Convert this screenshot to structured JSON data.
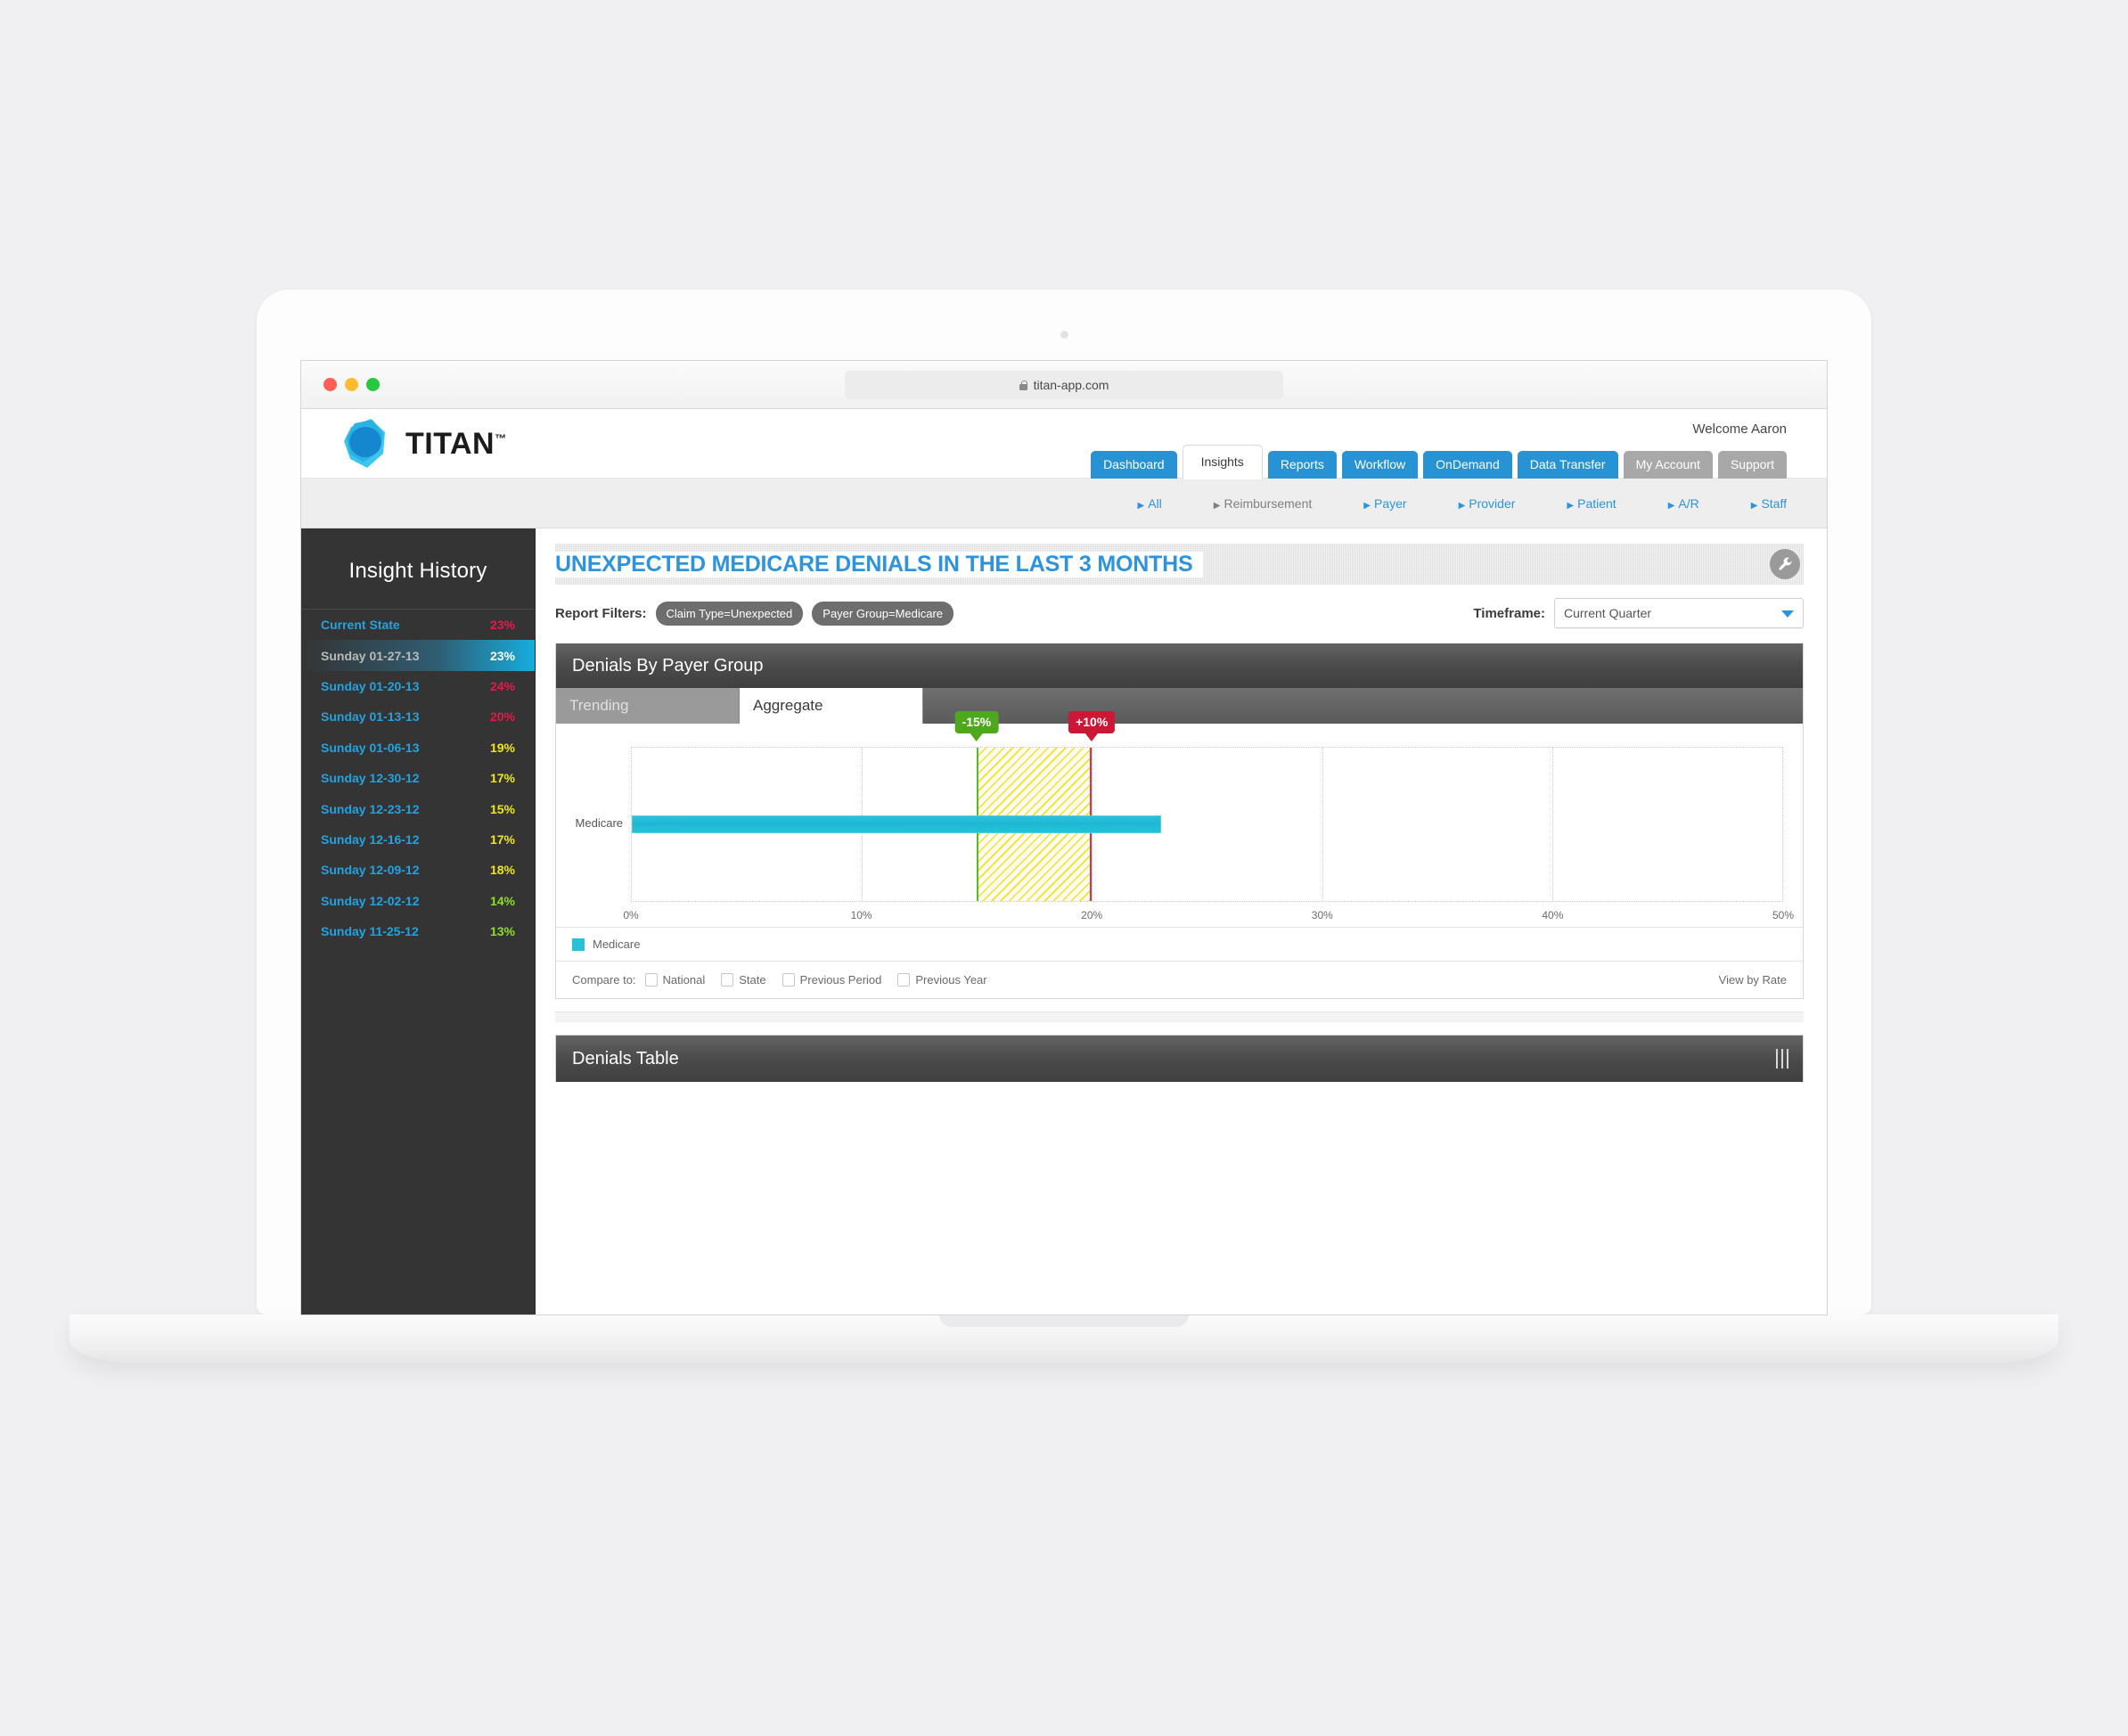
{
  "browser": {
    "url": "titan-app.com",
    "lock_icon": "lock-icon"
  },
  "header": {
    "logo_text": "TITAN",
    "logo_tm": "™",
    "welcome": "Welcome Aaron",
    "tabs": [
      {
        "label": "Dashboard",
        "state": "blue"
      },
      {
        "label": "Insights",
        "state": "active"
      },
      {
        "label": "Reports",
        "state": "blue"
      },
      {
        "label": "Workflow",
        "state": "blue"
      },
      {
        "label": "OnDemand",
        "state": "blue"
      },
      {
        "label": "Data Transfer",
        "state": "blue"
      },
      {
        "label": "My Account",
        "state": "grey"
      },
      {
        "label": "Support",
        "state": "grey"
      }
    ]
  },
  "subnav": {
    "items": [
      {
        "label": "All",
        "muted": false
      },
      {
        "label": "Reimbursement",
        "muted": true
      },
      {
        "label": "Payer",
        "muted": false
      },
      {
        "label": "Provider",
        "muted": false
      },
      {
        "label": "Patient",
        "muted": false
      },
      {
        "label": "A/R",
        "muted": false
      },
      {
        "label": "Staff",
        "muted": false
      }
    ]
  },
  "sidebar": {
    "title": "Insight History",
    "rows": [
      {
        "label": "Current State",
        "value": "23%",
        "color": "#e8184a",
        "selected": false
      },
      {
        "label": "Sunday 01-27-13",
        "value": "23%",
        "color": "#ffffff",
        "selected": true
      },
      {
        "label": "Sunday 01-20-13",
        "value": "24%",
        "color": "#e8184a",
        "selected": false
      },
      {
        "label": "Sunday 01-13-13",
        "value": "20%",
        "color": "#e8184a",
        "selected": false
      },
      {
        "label": "Sunday 01-06-13",
        "value": "19%",
        "color": "#efe715",
        "selected": false
      },
      {
        "label": "Sunday 12-30-12",
        "value": "17%",
        "color": "#efe715",
        "selected": false
      },
      {
        "label": "Sunday 12-23-12",
        "value": "15%",
        "color": "#efe715",
        "selected": false
      },
      {
        "label": "Sunday 12-16-12",
        "value": "17%",
        "color": "#efe715",
        "selected": false
      },
      {
        "label": "Sunday 12-09-12",
        "value": "18%",
        "color": "#efe715",
        "selected": false
      },
      {
        "label": "Sunday 12-02-12",
        "value": "14%",
        "color": "#8ddc2a",
        "selected": false
      },
      {
        "label": "Sunday 11-25-12",
        "value": "13%",
        "color": "#8ddc2a",
        "selected": false
      }
    ]
  },
  "report": {
    "title": "UNEXPECTED MEDICARE DENIALS IN THE LAST 3 MONTHS",
    "settings_icon": "wrench-icon",
    "filters_label": "Report Filters:",
    "filters": [
      "Claim Type=Unexpected",
      "Payer Group=Medicare"
    ],
    "timeframe_label": "Timeframe:",
    "timeframe_value": "Current Quarter",
    "timeframe_caret": "chevron-down-icon"
  },
  "chart_panel": {
    "title": "Denials By Payer Group",
    "tabs": [
      {
        "label": "Trending",
        "active": false
      },
      {
        "label": "Aggregate",
        "active": true
      }
    ],
    "legend_label": "Medicare",
    "compare_label": "Compare to:",
    "compare_options": [
      "National",
      "State",
      "Previous Period",
      "Previous Year"
    ],
    "view_by": "View by Rate"
  },
  "table_panel": {
    "title": "Denials Table",
    "drag_handle": "drag-handle-icon"
  },
  "chart_data": {
    "type": "bar",
    "orientation": "horizontal",
    "title": "Denials By Payer Group",
    "categories": [
      "Medicare"
    ],
    "series": [
      {
        "name": "Medicare",
        "values": [
          23
        ],
        "color": "#2ac0d8"
      }
    ],
    "xlabel": "",
    "ylabel": "",
    "xlim": [
      0,
      50
    ],
    "xticks": [
      0,
      10,
      20,
      30,
      40,
      50
    ],
    "xtick_labels": [
      "0%",
      "10%",
      "20%",
      "30%",
      "40%",
      "50%"
    ],
    "unit": "%",
    "grid": true,
    "legend_position": "bottom-left",
    "target_band": {
      "low": 15,
      "high": 20,
      "low_label": "-15%",
      "high_label": "+10%",
      "low_color": "#4ea81b",
      "high_color": "#cc1836",
      "fill": "#f3e02a",
      "style": "diagonal-hatch"
    }
  }
}
